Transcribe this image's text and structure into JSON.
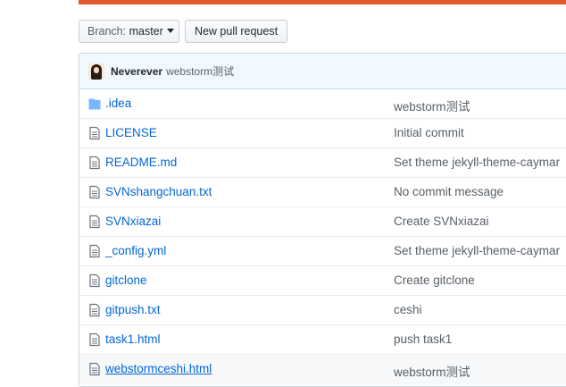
{
  "colors": {
    "top_bar": "#e4592b",
    "link": "#0366d6",
    "muted": "#586069",
    "commit_bar_bg": "#f1f8ff"
  },
  "branch": {
    "prefix": "Branch:",
    "name": "master"
  },
  "new_pull_request_label": "New pull request",
  "latest_commit": {
    "author": "Neverever",
    "message": "webstorm测试"
  },
  "files": [
    {
      "name": ".idea",
      "type": "folder",
      "message": "webstorm测试"
    },
    {
      "name": "LICENSE",
      "type": "file",
      "message": "Initial commit"
    },
    {
      "name": "README.md",
      "type": "file",
      "message": "Set theme jekyll-theme-caymar"
    },
    {
      "name": "SVNshangchuan.txt",
      "type": "file",
      "message": "No commit message"
    },
    {
      "name": "SVNxiazai",
      "type": "file",
      "message": "Create SVNxiazai"
    },
    {
      "name": "_config.yml",
      "type": "file",
      "message": "Set theme jekyll-theme-caymar"
    },
    {
      "name": "gitclone",
      "type": "file",
      "message": "Create gitclone"
    },
    {
      "name": "gitpush.txt",
      "type": "file",
      "message": "ceshi"
    },
    {
      "name": "task1.html",
      "type": "file",
      "message": "push task1"
    },
    {
      "name": "webstormceshi.html",
      "type": "file",
      "message": "webstorm测试"
    }
  ]
}
